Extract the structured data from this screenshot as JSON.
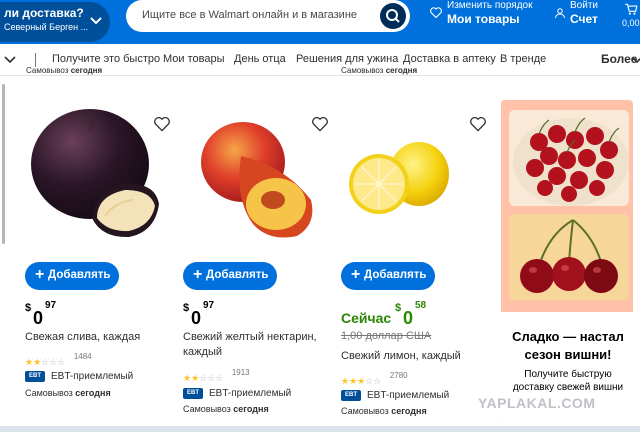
{
  "header": {
    "pickup_question": "ли доставка?",
    "pickup_address": "Северный Берген ...",
    "search_placeholder": "Ищите все в Walmart онлайн и в магазине",
    "reorder_line1": "Изменить порядок",
    "reorder_line2": "Мои товары",
    "account_line1": "Войти",
    "account_line2": "Счет",
    "cart_amount": "0,00",
    "brand_color": "#0071dc"
  },
  "nav": {
    "items": [
      "Получите это быстро",
      "Мои товары",
      "День отца",
      "Решения для ужина",
      "Доставка в аптеку",
      "В тренде"
    ],
    "more": "Более"
  },
  "pickup_prefix": "Самовывоз",
  "pickup_today": "сегодня",
  "products": [
    {
      "add_label": "Добавлять",
      "price_currency": "$",
      "price_dollars": "0",
      "price_cents": "97",
      "name": "Свежая слива, каждая",
      "rating_stars": 2,
      "rating_count": "1484",
      "ebt": "EBT-приемлемый",
      "ebt_badge": "EBT",
      "shipping_prefix": "Самовывоз",
      "shipping_day": "сегодня"
    },
    {
      "add_label": "Добавлять",
      "price_currency": "$",
      "price_dollars": "0",
      "price_cents": "97",
      "name": "Свежий желтый нектарин, каждый",
      "rating_stars": 2,
      "rating_count": "1913",
      "ebt": "EBT-приемлемый",
      "ebt_badge": "EBT",
      "shipping_prefix": "Самовывоз",
      "shipping_day": "сегодня"
    },
    {
      "add_label": "Добавлять",
      "now_label": "Сейчас",
      "price_currency": "$",
      "price_dollars": "0",
      "price_cents": "58",
      "was_price": "1,00 доллар США",
      "name": "Свежий лимон, каждый",
      "rating_stars": 3,
      "rating_count": "2780",
      "ebt": "EBT-приемлемый",
      "ebt_badge": "EBT",
      "shipping_prefix": "Самовывоз",
      "shipping_day": "сегодня"
    }
  ],
  "promo": {
    "title": "Сладко — настал сезон вишни!",
    "subtitle": "Получите быструю доставку свежей вишни"
  },
  "watermark": "YAPLAKAL.COM"
}
